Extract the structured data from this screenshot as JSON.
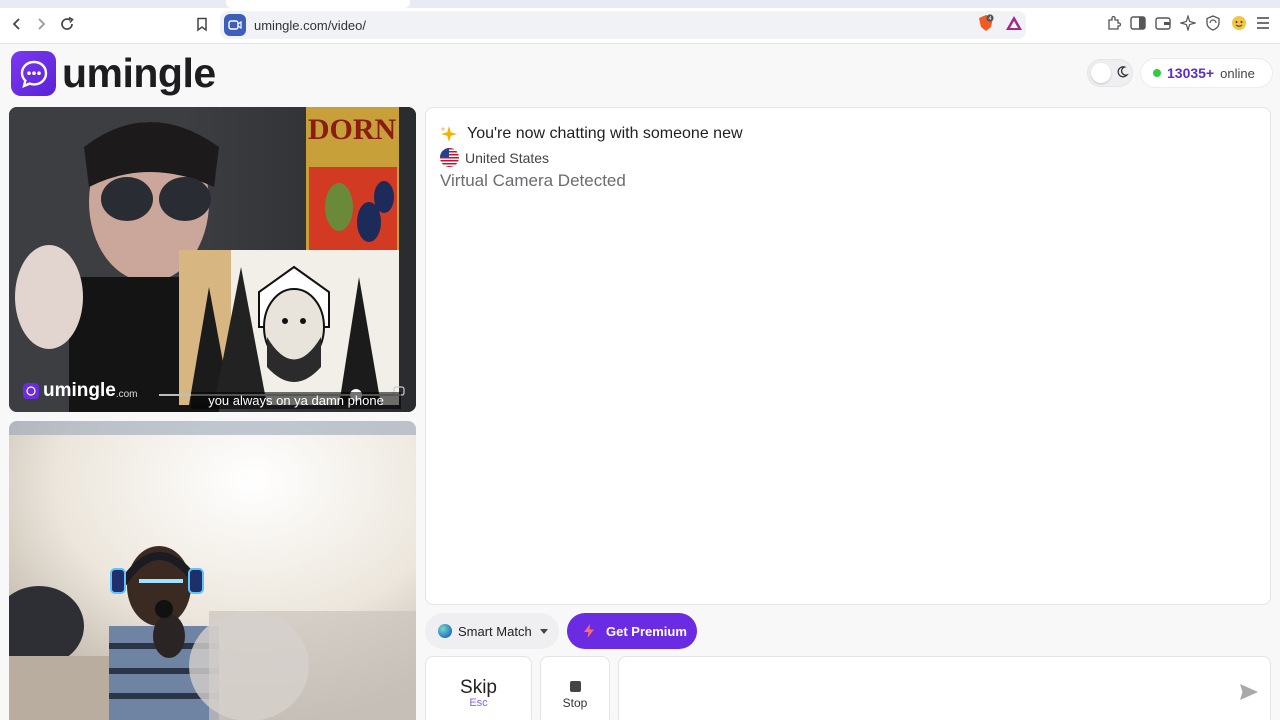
{
  "browser": {
    "url": "umingle.com/video/",
    "icons": [
      "back-icon",
      "forward-icon",
      "reload-icon",
      "bookmark-icon",
      "brave-shield-icon",
      "brave-rewards-icon",
      "extensions-icon",
      "sidebar-icon",
      "wallet-icon",
      "leo-icon",
      "vpn-icon",
      "profile-icon",
      "menu-icon"
    ]
  },
  "header": {
    "brand": "umingle",
    "online_count": "13035+",
    "online_label": "online"
  },
  "remote_video": {
    "watermark_brand": "umingle",
    "watermark_suffix": ".com",
    "caption": "you always on ya damn phone",
    "poster_text": "DORN"
  },
  "chat": {
    "status": "You're now chatting with someone new",
    "country": "United States",
    "notice": "Virtual Camera Detected"
  },
  "controls": {
    "smart_match": "Smart Match",
    "premium": "Get Premium",
    "skip": "Skip",
    "skip_key": "Esc",
    "stop": "Stop",
    "message_placeholder": ""
  },
  "colors": {
    "brand_purple": "#6a2be2",
    "online_green": "#2ecc40",
    "count_purple": "#5b2bd6"
  }
}
